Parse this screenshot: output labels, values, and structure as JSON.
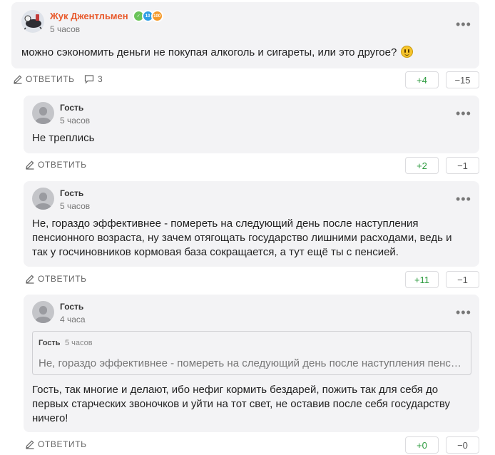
{
  "colors": {
    "accent_author": "#e8592b",
    "vote_plus": "#2d9b3f",
    "card_bg": "#f3f3f5"
  },
  "icons": {
    "reply": "pencil-icon",
    "comments": "speech-bubble-icon",
    "more": "more-dots-icon"
  },
  "main_comment": {
    "author": "Жук Джентльмен",
    "badges": [
      {
        "icon": "check-badge-icon",
        "label": "",
        "color": "#6bc45a"
      },
      {
        "icon": "level-badge-icon",
        "label": "10",
        "color": "#2f9ee6"
      },
      {
        "icon": "level-badge-icon",
        "label": "100",
        "color": "#f59a2b"
      }
    ],
    "time": "5 часов",
    "text": "можно сэкономить деньги не покупая алкоголь и сигареты, или это другое?",
    "reply_label": "ОТВЕТИТЬ",
    "replies_count": "3",
    "upvotes": "+4",
    "downvotes": "−15"
  },
  "replies": [
    {
      "author": "Гость",
      "time": "5 часов",
      "text": "Не треплись",
      "reply_label": "ОТВЕТИТЬ",
      "upvotes": "+2",
      "downvotes": "−1"
    },
    {
      "author": "Гость",
      "time": "5 часов",
      "text": "Не, гораздо эффективнее - помереть на следующий день после наступления пенсионного возраста, ну зачем отягощать государство лишними расходами, ведь и так у госчиновников кормовая база сокращается, а тут ещё ты с пенсией.",
      "reply_label": "ОТВЕТИТЬ",
      "upvotes": "+11",
      "downvotes": "−1"
    },
    {
      "author": "Гость",
      "time": "4 часа",
      "quote": {
        "author": "Гость",
        "time": "5 часов",
        "text": "Не, гораздо эффективнее - помереть на следующий день после наступления пенсионного возраста, ну зачем отягощать государство лишними расходами, ведь и так у госчиновников кормовая база сокращается, а тут ещё ты с пенсией."
      },
      "text": "Гость, так многие и делают, ибо нефиг кормить бездарей, пожить так для себя до первых старческих звоночков и уйти на тот свет, не оставив после себя государству ничего!",
      "reply_label": "ОТВЕТИТЬ",
      "upvotes": "+0",
      "downvotes": "−0"
    }
  ]
}
